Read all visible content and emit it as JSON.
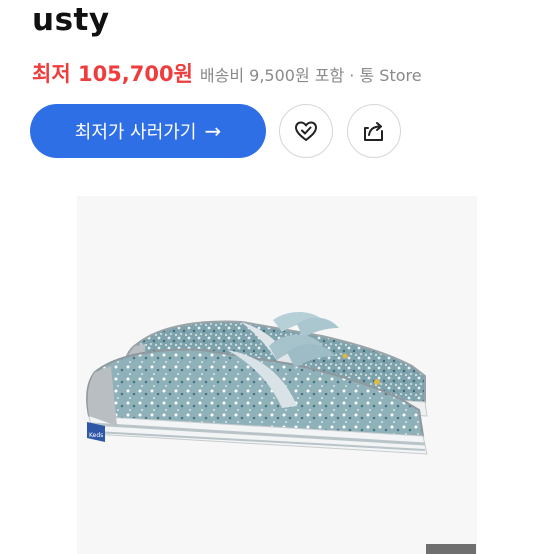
{
  "header": {
    "title": "usty"
  },
  "price": {
    "lowest_label_price": "최저 105,700원",
    "meta": "배송비 9,500원 포함 · 통 Store"
  },
  "actions": {
    "buy_label": "최저가 사러가기",
    "buy_arrow": "→",
    "wishlist_icon": "heart-check-icon",
    "share_icon": "share-icon"
  },
  "product": {
    "image": "glitter-sneaker-icon",
    "brand_tag": "Keds"
  },
  "colors": {
    "accent": "#2f6fe6",
    "price": "#ef3d3d"
  }
}
